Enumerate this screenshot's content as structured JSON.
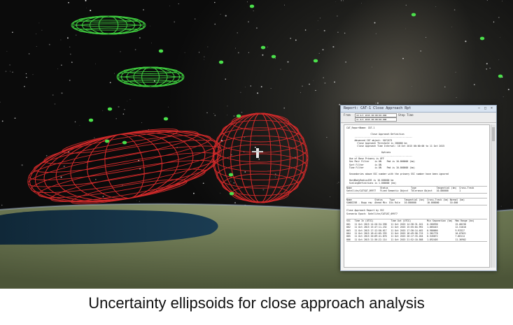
{
  "caption": "Uncertainty ellipsoids for close approach analysis",
  "colors": {
    "ellipsoid_red": "#d02a2a",
    "ellipsoid_green": "#3ec83e",
    "satellite_dots": "#4be04b",
    "window_titlebar": "#d9e4f1"
  },
  "report_window": {
    "title": "Report: CAT-1 Close Approach Rpt",
    "minimize_icon": "minimize-icon",
    "maximize_icon": "maximize-icon",
    "close_icon": "close-icon",
    "toolbar": {
      "label_from": "From",
      "label_to": "Stop Time",
      "start_value": "10 Oct 2015 00:00:00.000",
      "stop_value": "11 Oct 2015 00:00:00.000"
    },
    "lines": [
      "CAT_ReportName: CAT-1",
      " ",
      "                  Close Approach Definition",
      "      -------------------------------------------",
      "      Advanced CAT object: SATCAT3",
      "        Close Approach Threshold is 200000 km",
      "        Close Approach Time Interval: 10 Oct 2015 00:00:00 to 11 Oct 2015",
      " ",
      "                          Options",
      "      -------------------------------------------",
      "  Use of Base Primary is OFF",
      "  Sec Pair Filter    is ON    Pad is 10.000000 (km)",
      "  Sort Filter        is ON",
      "  Time Filter        is ON    Pad is 10.000000 (km)",
      " ",
      "  Secondaries above SSC number with the primary SSC number have been ignored",
      " ",
      "  HardBodyRadiusIDS is 10.000000 km",
      "  ScalingDefinitions is 1.000000 (km)"
    ],
    "table1_headers": [
      "Name",
      "Status",
      "Type",
      "Tangential (km)",
      "Cross-Track"
    ],
    "table1_rows": [
      [
        "Satellite/CATSAT_09977",
        "Fixed Semantic Object",
        "Tolerance Object",
        "10.000000",
        "1"
      ]
    ],
    "table2_headers": [
      "Name",
      "Status",
      "Type",
      "Tangential (km)",
      "Cross-Track (km)",
      "Normal (km)"
    ],
    "table2_rows": [
      [
        "SAW02258 - Bupp raw",
        "Ahead Min",
        "Dis Rule",
        "10.000000",
        "10.000000",
        "10.000"
      ]
    ],
    "section_title": "Close Approach Report by SSC",
    "section_sub": "Scenario Epoch: Satellite/CATSAT_09977",
    "table3_headers": [
      "SSC",
      "Time In (UTCG)",
      "Time Out (UTCG)",
      "Min Separation (km)",
      "Max Range (km)"
    ],
    "table3_rows": [
      [
        "001",
        "11 Oct 2015 14:20:34.598",
        "11 Oct 2015 14:38:31.101",
        "0.260590",
        "15.00238"
      ],
      [
        "002",
        "11 Oct 2015 15:47:11.232",
        "11 Oct 2015 15:55:04.992",
        "1.005443",
        "12.51010"
      ],
      [
        "003",
        "11 Oct 2015 17:12:50.617",
        "11 Oct 2015 17:30:14.402",
        "0.980066",
        "9.93327"
      ],
      [
        "004",
        "11 Oct 2015 18:41:05.333",
        "11 Oct 2015 18:49:58.715",
        "2.301778",
        "10.87021"
      ],
      [
        "005",
        "11 Oct 2015 20:09:41.870",
        "11 Oct 2015 20:17:33.204",
        "0.545072",
        "7.00114"
      ],
      [
        "006",
        "11 Oct 2015 21:36:22.114",
        "11 Oct 2015 21:52:10.588",
        "1.892405",
        "11.36902"
      ]
    ]
  }
}
